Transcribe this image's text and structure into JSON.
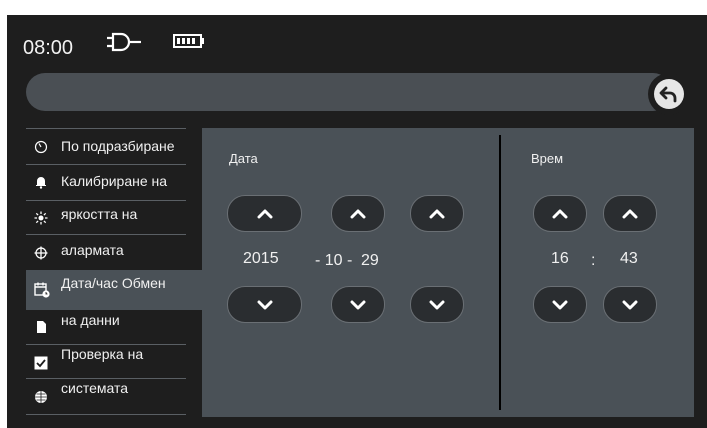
{
  "status": {
    "time": "08:00"
  },
  "sidebar": {
    "items": [
      {
        "label": "По подразбиране",
        "icon": "gauge-icon"
      },
      {
        "label": "Калибриране на",
        "icon": "bell-icon"
      },
      {
        "label": "яркостта на",
        "icon": "brightness-icon"
      },
      {
        "label": "алармата",
        "icon": "crosshair-icon"
      },
      {
        "label": "Дата/час Обмен",
        "icon": "calendar-clock-icon"
      },
      {
        "label": "на данни",
        "icon": "sd-card-icon"
      },
      {
        "label": "Проверка на",
        "icon": "checkbox-icon"
      },
      {
        "label": "системата",
        "icon": "globe-icon"
      }
    ]
  },
  "date": {
    "label": "Дата",
    "year": "2015",
    "month": "- 10 -",
    "day": "29"
  },
  "time": {
    "label": "Врем",
    "hour": "16",
    "separator": ":",
    "minute": "43"
  },
  "colors": {
    "background": "#1e1e1e",
    "panel": "#4a5157",
    "bar": "#4a4f54"
  }
}
